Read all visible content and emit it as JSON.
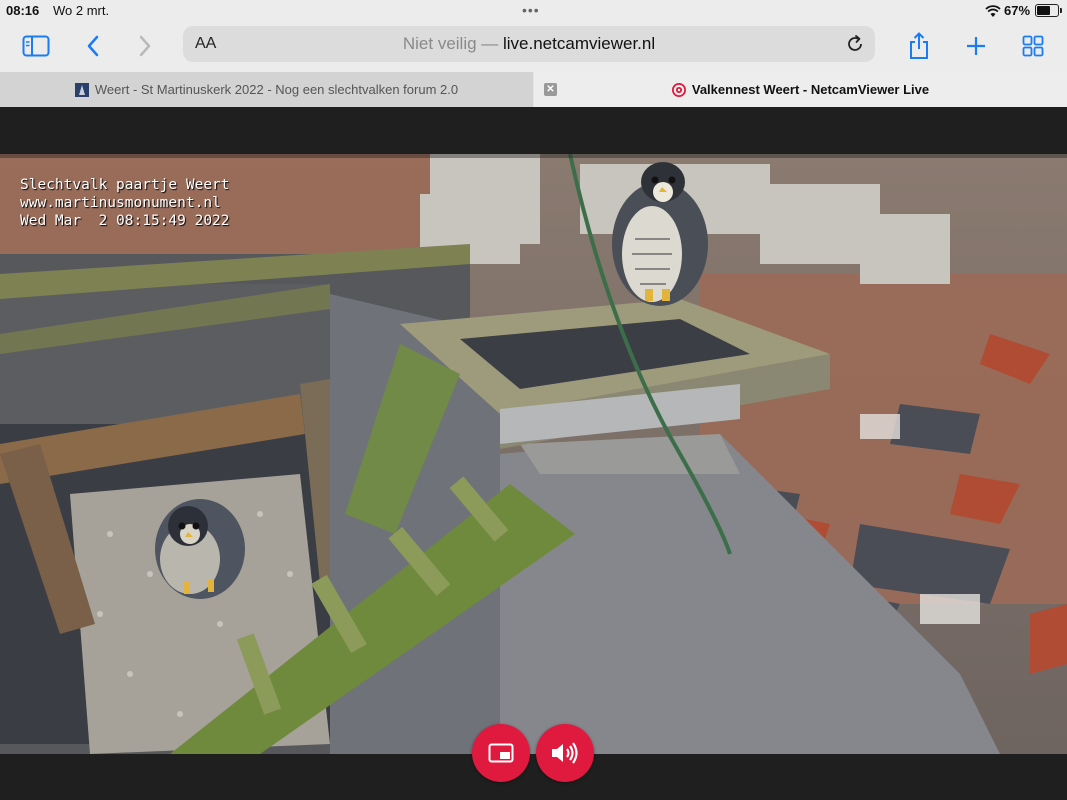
{
  "status_bar": {
    "time": "08:16",
    "date": "Wo 2 mrt.",
    "battery_percent": "67%",
    "battery_level": 0.67
  },
  "toolbar": {
    "aa_label": "AA",
    "url_prefix": "Niet veilig — ",
    "url_domain": "live.netcamviewer.nl",
    "icons": [
      "sidebar-icon",
      "back-icon",
      "forward-icon",
      "reload-icon",
      "share-icon",
      "plus-icon",
      "tabs-grid-icon"
    ]
  },
  "tabs": [
    {
      "title": "Weert - St Martinuskerk 2022 - Nog een slechtvalken forum 2.0",
      "active": false
    },
    {
      "title": "Valkennest Weert - NetcamViewer Live",
      "active": true
    }
  ],
  "video": {
    "overlay_lines": [
      "Slechtvalk paartje Weert",
      "www.martinusmonument.nl",
      "Wed Mar  2 08:15:49 2022"
    ]
  },
  "controls": {
    "buttons": [
      "picture-in-picture-icon",
      "speaker-icon"
    ]
  },
  "colors": {
    "accent_red": "#e0193f",
    "toolbar_blue": "#1a7cf5",
    "chrome_bg": "#ececec"
  }
}
